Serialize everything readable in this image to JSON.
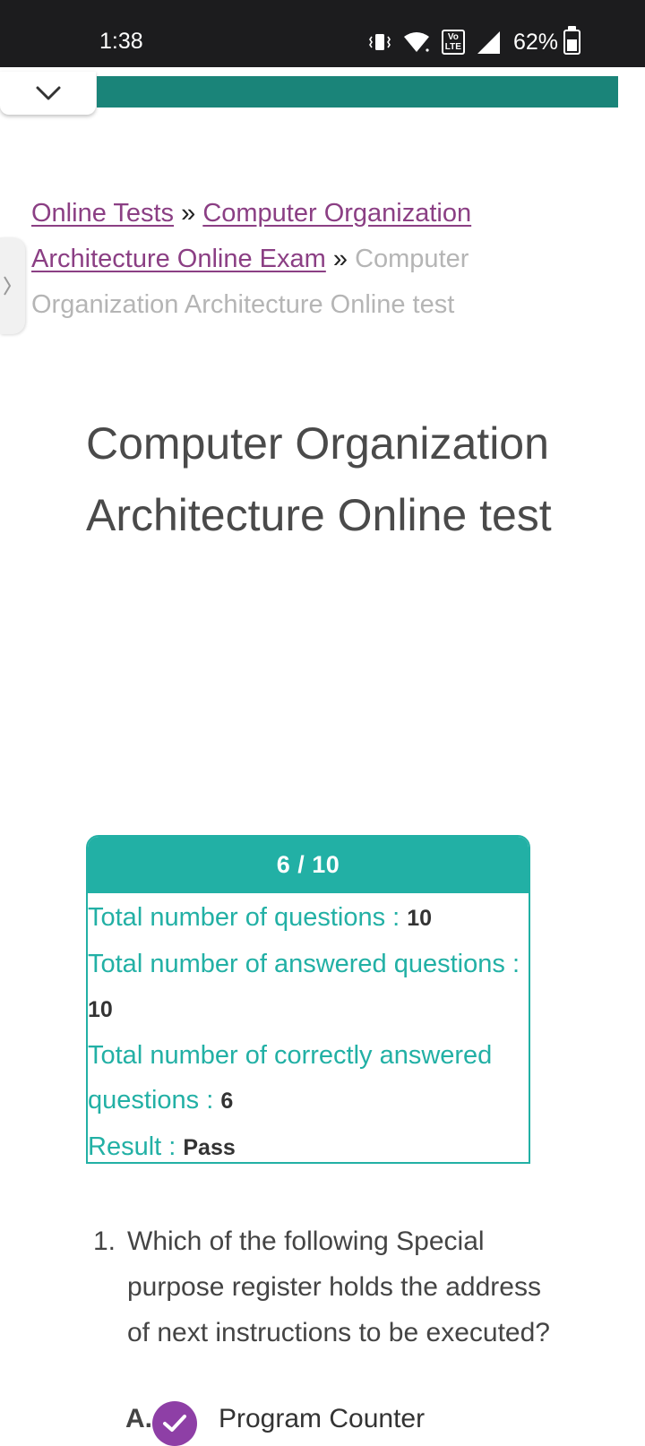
{
  "status_bar": {
    "time": "1:38",
    "volte": "Vo LTE",
    "battery": "62%",
    "icons": [
      "vibrate-icon",
      "wifi-icon",
      "volte-icon",
      "signal-icon",
      "battery-icon"
    ]
  },
  "colors": {
    "banner": "#1a8479",
    "result_accent": "#22b0a5",
    "link": "#8b3f84",
    "check": "#8e3fa6"
  },
  "breadcrumb": {
    "link1": "Online Tests",
    "link2": "Computer Organization Architecture Online Exam",
    "separator": "»",
    "current": "Computer Organization Architecture Online test"
  },
  "page_title": "Computer Organization Architecture Online test",
  "result": {
    "score": "6 / 10",
    "total_label": "Total number of questions : ",
    "total_value": "10",
    "answered_label": "Total number of answered questions : ",
    "answered_value": "10",
    "correct_label": "Total number of correctly answered questions : ",
    "correct_value": "6",
    "result_label": "Result : ",
    "result_value": "Pass"
  },
  "question": {
    "number": "1.",
    "text": "Which of the following Special purpose register holds the address of next instructions to be executed?",
    "option_letter": "A.",
    "option_text": "Program Counter"
  }
}
